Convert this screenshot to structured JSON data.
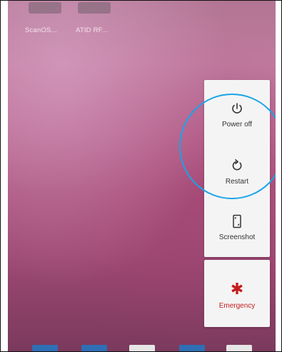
{
  "home_screen": {
    "apps": [
      {
        "label": "ScanOS..."
      },
      {
        "label": "ATID RF..."
      }
    ]
  },
  "power_menu": {
    "items": [
      {
        "label": "Power off",
        "icon": "power-icon"
      },
      {
        "label": "Restart",
        "icon": "restart-icon"
      },
      {
        "label": "Screenshot",
        "icon": "screenshot-icon"
      }
    ]
  },
  "emergency": {
    "label": "Emergency",
    "icon": "emergency-asterisk-icon",
    "color": "#c41c1c"
  },
  "annotation": {
    "color": "#1aa3e8"
  },
  "colors": {
    "menu_background": "#f4f4f4",
    "dock_blue": "#2f6fb5"
  }
}
